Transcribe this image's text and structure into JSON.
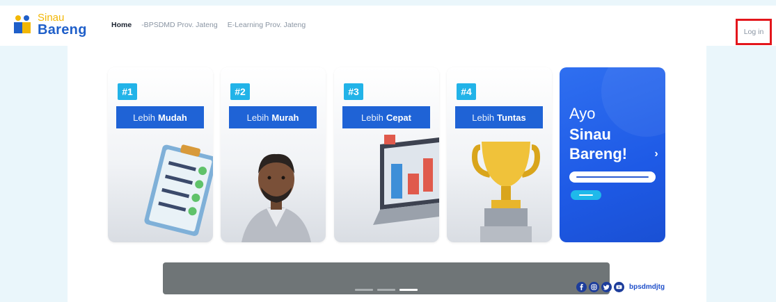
{
  "brand": {
    "logo_top": "Sinau",
    "logo_bottom": "Bareng",
    "colors": {
      "top": "#f2b705",
      "bottom": "#1f5fc9"
    }
  },
  "nav": {
    "links": [
      "Home",
      "-BPSDMD Prov. Jateng",
      "E-Learning Prov. Jateng"
    ],
    "active": "Home"
  },
  "login_label": "Log in",
  "cards": [
    {
      "badge": "#1",
      "prefix": "Lebih",
      "word": "Mudah",
      "icon": "clipboard-checklist-icon"
    },
    {
      "badge": "#2",
      "prefix": "Lebih",
      "word": "Murah",
      "icon": "man-avatar-icon"
    },
    {
      "badge": "#3",
      "prefix": "Lebih",
      "word": "Cepat",
      "icon": "laptop-chart-icon"
    },
    {
      "badge": "#4",
      "prefix": "Lebih",
      "word": "Tuntas",
      "icon": "trophy-icon"
    }
  ],
  "promo": {
    "line1": "Ayo",
    "line2": "Sinau",
    "line3": "Bareng!"
  },
  "carousel": {
    "slide_count": 3,
    "active_slide": 3
  },
  "social": {
    "icons": [
      "facebook-icon",
      "instagram-icon",
      "twitter-icon",
      "youtube-icon"
    ],
    "handle": "bpsdmdjtg"
  },
  "accent_colors": {
    "blue": "#1f63d6",
    "cyan": "#22b3e8",
    "login_highlight": "#e3161c"
  }
}
